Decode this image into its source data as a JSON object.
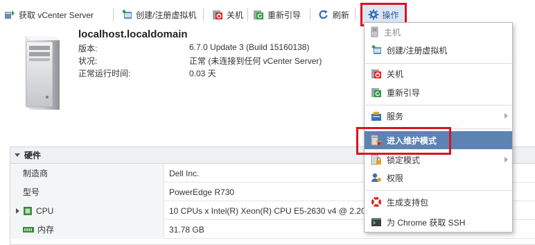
{
  "toolbar": {
    "get_vcenter": "获取 vCenter Server",
    "create_vm": "创建/注册虚拟机",
    "shutdown": "关机",
    "reboot": "重新引导",
    "refresh": "刷新",
    "actions": "操作"
  },
  "host": {
    "name": "localhost.localdomain",
    "version_label": "版本:",
    "version_value": "6.7.0 Update 3 (Build 15160138)",
    "status_label": "状况:",
    "status_value": "正常 (未连接到任何 vCenter Server)",
    "uptime_label": "正常运行时间:",
    "uptime_value": "0.03 天"
  },
  "hardware": {
    "title": "硬件",
    "rows": [
      {
        "key": "制造商",
        "value": "Dell Inc."
      },
      {
        "key": "型号",
        "value": "PowerEdge R730"
      },
      {
        "key": "CPU",
        "value": "10 CPUs x Intel(R) Xeon(R) CPU E5-2630 v4 @ 2.20"
      },
      {
        "key": "内存",
        "value": "31.78 GB"
      }
    ]
  },
  "menu": {
    "header": "主机",
    "items": [
      "创建/注册虚拟机",
      "关机",
      "重新引导",
      "服务",
      "进入维护模式",
      "锁定模式",
      "权限",
      "生成支持包",
      "为 Chrome 获取 SSH"
    ]
  },
  "colors": {
    "highlight_border": "#d9141e",
    "menu_selected": "#5d83b3",
    "link_blue": "#2a5a99"
  },
  "icons": [
    "vcenter-icon",
    "create-vm-icon",
    "shutdown-icon",
    "reboot-icon",
    "refresh-icon",
    "gear-icon",
    "server-icon",
    "services-icon",
    "maintenance-icon",
    "lockdown-icon",
    "permissions-icon",
    "support-bundle-icon",
    "ssh-icon",
    "cpu-icon",
    "memory-icon"
  ]
}
